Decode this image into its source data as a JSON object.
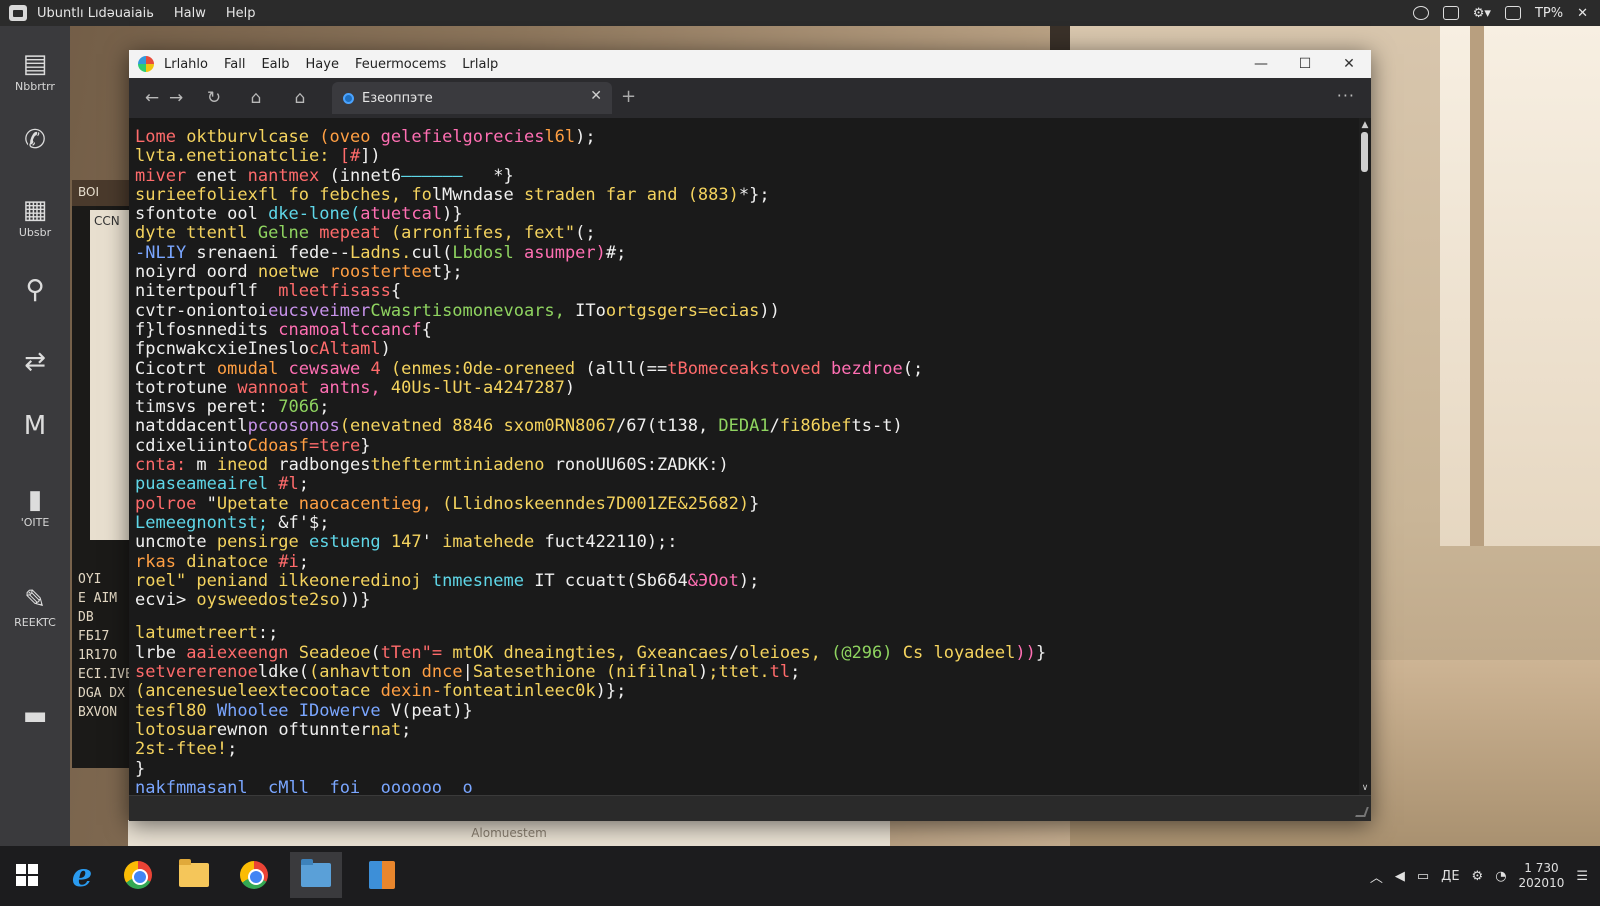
{
  "topbar": {
    "app_name": "Ubuntlı Lıdəuaiaiь",
    "menus": [
      "Halw",
      "Help"
    ],
    "battery": "TP%"
  },
  "dock": {
    "items": [
      {
        "label": "Nbbrtrr",
        "icon": "document-icon"
      },
      {
        "label": "",
        "icon": "phone-icon"
      },
      {
        "label": "Ubsbr",
        "icon": "notes-icon"
      },
      {
        "label": "",
        "icon": "search-icon"
      },
      {
        "label": "",
        "icon": "transfer-icon"
      },
      {
        "label": "",
        "icon": "mail-icon"
      },
      {
        "label": "'OITE",
        "icon": "file-icon"
      },
      {
        "label": "REEKTC",
        "icon": "edit-icon"
      },
      {
        "label": "",
        "icon": "folder-icon"
      }
    ]
  },
  "background_doc": {
    "header": "BOI",
    "paper_text": "CCN",
    "lines": [
      "OYI",
      "E AIM",
      "DB",
      "FБ17",
      "1R17O",
      "ECI.IVE",
      "DGA DX",
      "BXVON"
    ]
  },
  "background_status": "Alomuestem",
  "window": {
    "menus": [
      "Lrlahlo",
      "Fall",
      "Ealb",
      "Haye",
      "Feuermocems",
      "Lrlalp"
    ],
    "controls": {
      "minimize": "—",
      "maximize": "☐",
      "close": "✕"
    },
    "nav": {
      "back": "←",
      "forward": "→",
      "reload": "↻",
      "home": "⌂",
      "home2": "⌂",
      "more": "···",
      "new_tab": "+"
    },
    "tab": {
      "title": "Eзеоппэте",
      "close": "✕"
    }
  },
  "code": [
    [
      [
        "c-red",
        "Lome "
      ],
      [
        "c-yellow",
        "oktburvlcase "
      ],
      [
        "c-orange",
        "(oveo "
      ],
      [
        "c-pink",
        "gelefielgorecies"
      ],
      [
        "c-orange",
        "l6l"
      ],
      [
        "c-white",
        ");"
      ]
    ],
    [
      [
        "c-yellow",
        "lvta.enetionatclie: "
      ],
      [
        "c-red",
        "[#"
      ],
      [
        "c-white",
        "])"
      ]
    ],
    [
      [
        "c-red",
        "miver "
      ],
      [
        "c-white",
        "enet "
      ],
      [
        "c-red",
        "nantmex "
      ],
      [
        "c-white",
        "(innet6"
      ],
      [
        "c-cyan",
        "——————"
      ],
      [
        "c-white",
        "   *}"
      ]
    ],
    [
      [
        "c-yellow",
        "surieefoliexfl fo febches, fo"
      ],
      [
        "c-white",
        "lMwndase "
      ],
      [
        "c-yellow",
        "straden far and (883)"
      ],
      [
        "c-white",
        "*};"
      ]
    ],
    [
      [
        "c-white",
        "sfontote ool "
      ],
      [
        "c-cyan",
        "dke-lone("
      ],
      [
        "c-pink",
        "atuetcal"
      ],
      [
        "c-white",
        ")}"
      ]
    ],
    [
      [
        "c-yellow",
        "dyte ttentl "
      ],
      [
        "c-green",
        "Gelne "
      ],
      [
        "c-red",
        "mepeat "
      ],
      [
        "c-yellow",
        "(arronfifes, fext\""
      ],
      [
        "c-white",
        "(;"
      ]
    ],
    [
      [
        "c-blue",
        "-NLIY "
      ],
      [
        "c-white",
        "srenaeni "
      ],
      [
        "c-white",
        "fede--"
      ],
      [
        "c-yellow",
        "Ladns."
      ],
      [
        "c-white",
        "cul("
      ],
      [
        "c-green",
        "Lbdosl "
      ],
      [
        "c-pink",
        "asumper)"
      ],
      [
        "c-white",
        "#;"
      ]
    ],
    [
      [
        "c-white",
        "noiyrd oord "
      ],
      [
        "c-yellow",
        "noetwe "
      ],
      [
        "c-orange",
        "roostertee"
      ],
      [
        "c-white",
        "t};"
      ]
    ],
    [
      [
        "c-white",
        "nitertpouflf  "
      ],
      [
        "c-red",
        "mleetfisass"
      ],
      [
        "c-white",
        "{"
      ]
    ],
    [
      [
        "c-white",
        "cvtr-oniontoi"
      ],
      [
        "c-purple",
        "eucsveimer"
      ],
      [
        "c-green",
        "Cwasrtisomonevoars, "
      ],
      [
        "c-white",
        "ITo"
      ],
      [
        "c-yellow",
        "ortgsgers=ecias"
      ],
      [
        "c-white",
        "))"
      ]
    ],
    [
      [
        "c-white",
        "f}lfosnnedits "
      ],
      [
        "c-pink",
        "cnamoaltccancf"
      ],
      [
        "c-white",
        "{"
      ]
    ],
    [
      [
        "c-white",
        "fpcnwakcxieIneslo"
      ],
      [
        "c-red",
        "cAltaml"
      ],
      [
        "c-white",
        ")"
      ]
    ],
    [
      [
        "c-white",
        "Cicotrt "
      ],
      [
        "c-orange",
        "omudal "
      ],
      [
        "c-pink",
        "cewsawe "
      ],
      [
        "c-red",
        "4 "
      ],
      [
        "c-yellow",
        "(enmes:0de-oreneed "
      ],
      [
        "c-white",
        "(alll(=="
      ],
      [
        "c-red",
        "tBomeceakstoved "
      ],
      [
        "c-pink",
        "bezdroe"
      ],
      [
        "c-white",
        "(;"
      ]
    ],
    [
      [
        "c-white",
        "totrotune "
      ],
      [
        "c-red",
        "wannoat "
      ],
      [
        "c-pink",
        "antns, "
      ],
      [
        "c-yellow",
        "40Us-lUt-a4247287"
      ],
      [
        "c-white",
        ")"
      ]
    ],
    [
      [
        "c-white",
        "timsvs peret: "
      ],
      [
        "c-green",
        "706б"
      ],
      [
        "c-white",
        ";"
      ]
    ],
    [
      [
        "c-white",
        "natddacentl"
      ],
      [
        "c-purple",
        "pcoosonos"
      ],
      [
        "c-yellow",
        "(enevatned 8846 sxom0RN8067"
      ],
      [
        "c-white",
        "/67(t138, "
      ],
      [
        "c-green",
        "DEDA1"
      ],
      [
        "c-white",
        "/"
      ],
      [
        "c-yellow",
        "fi86bef"
      ],
      [
        "c-white",
        "ts-t)"
      ]
    ],
    [
      [
        "c-white",
        "cdixeliinto"
      ],
      [
        "c-orange",
        "Cdoasf"
      ],
      [
        "c-red",
        "=tere"
      ],
      [
        "c-white",
        "}"
      ]
    ],
    [
      [
        "c-red",
        "cnta: "
      ],
      [
        "c-white",
        "m "
      ],
      [
        "c-yellow",
        "ineod "
      ],
      [
        "c-white",
        "radbonges"
      ],
      [
        "c-yellow",
        "theftermtiniadeno "
      ],
      [
        "c-white",
        "ronoUU60S:ZADKK:)"
      ]
    ],
    [
      [
        "c-cyan",
        "puaseameairel "
      ],
      [
        "c-red",
        "#l"
      ],
      [
        "c-white",
        ";"
      ]
    ],
    [
      [
        "c-red",
        "polroe "
      ],
      [
        "c-white",
        "\""
      ],
      [
        "c-yellow",
        "Upetate "
      ],
      [
        "c-orange",
        "naocacentieg, "
      ],
      [
        "c-yellow",
        "(Llidnoskeenndes7D001ZE&25682)"
      ],
      [
        "c-white",
        "}"
      ]
    ],
    [
      [
        "c-cyan",
        "Lemeegnontst; "
      ],
      [
        "c-white",
        "&f'$;"
      ]
    ],
    [
      [
        "c-white",
        "uncmote "
      ],
      [
        "c-yellow",
        "pensirge "
      ],
      [
        "c-cyan",
        "estueng "
      ],
      [
        "c-yellow",
        "147"
      ],
      [
        "c-white",
        "' "
      ],
      [
        "c-yellow",
        "imatehede "
      ],
      [
        "c-white",
        "fuct422110);:"
      ]
    ],
    [
      [
        "c-orange",
        "rkas "
      ],
      [
        "c-yellow",
        "dinatoce "
      ],
      [
        "c-red",
        "#i"
      ],
      [
        "c-white",
        ";"
      ]
    ],
    [
      [
        "c-yellow",
        "roel\" peniand "
      ],
      [
        "c-yellow",
        "ilkeoneredinoj "
      ],
      [
        "c-cyan",
        "tnmesneme "
      ],
      [
        "c-white",
        "IT ccuatt(Sb6δ4"
      ],
      [
        "c-pink",
        "&ЭOot"
      ],
      [
        "c-white",
        ");"
      ]
    ],
    [
      [
        "c-white",
        "ecvi> "
      ],
      [
        "c-yellow",
        "oysweedoste2so"
      ],
      [
        "c-white",
        "))}"
      ]
    ],
    [
      [
        "gap",
        ""
      ]
    ],
    [
      [
        "c-yellow",
        "latumetreert"
      ],
      [
        "c-white",
        ":;"
      ]
    ],
    [
      [
        "c-white",
        "lrbe "
      ],
      [
        "c-red",
        "aaiexeengn "
      ],
      [
        "c-yellow",
        "Seadeoe"
      ],
      [
        "c-white",
        "("
      ],
      [
        "c-red",
        "tTen\"= "
      ],
      [
        "c-yellow",
        "mtOK "
      ],
      [
        "c-yellow",
        "dneaingties, "
      ],
      [
        "c-yellow",
        "Gxeancaes"
      ],
      [
        "c-white",
        "/"
      ],
      [
        "c-yellow",
        "oleioes, "
      ],
      [
        "c-green",
        "(@296) "
      ],
      [
        "c-yellow",
        "Cs "
      ],
      [
        "c-yellow",
        "loyadeel"
      ],
      [
        "c-pink",
        "))"
      ],
      [
        "c-white",
        "}"
      ]
    ],
    [
      [
        "c-red",
        "setvererenoe"
      ],
      [
        "c-white",
        "ldke("
      ],
      [
        "c-yellow",
        "(anhavtton "
      ],
      [
        "c-orange",
        "dnce"
      ],
      [
        "c-white",
        "|"
      ],
      [
        "c-yellow",
        "Satesethione "
      ],
      [
        "c-yellow",
        "(nifilnal"
      ],
      [
        "c-white",
        ")"
      ],
      [
        "c-yellow",
        ";ttet."
      ],
      [
        "c-red",
        "tl"
      ],
      [
        "c-white",
        ";"
      ]
    ],
    [
      [
        "c-yellow",
        "(ancenesueleextecootace "
      ],
      [
        "c-orange",
        "dexin-"
      ],
      [
        "c-yellow",
        "fonteatinleec0k"
      ],
      [
        "c-white",
        ")};"
      ]
    ],
    [
      [
        "c-yellow",
        "tesfl80 "
      ],
      [
        "c-blue",
        "Whoolee "
      ],
      [
        "c-blue",
        "IDowerve "
      ],
      [
        "c-white",
        "V(peat)}"
      ]
    ],
    [
      [
        "c-yellow",
        "lotosuar"
      ],
      [
        "c-white",
        "ewnon "
      ],
      [
        "c-white",
        "oftunnter"
      ],
      [
        "c-yellow",
        "nat"
      ],
      [
        "c-white",
        ";"
      ]
    ],
    [
      [
        "c-yellow",
        "2st-ftee!"
      ],
      [
        "c-white",
        ";"
      ]
    ],
    [
      [
        "c-white",
        "}"
      ]
    ],
    [
      [
        "c-blue",
        "nakfmmasanl  cMll  foi  oooooo  o"
      ]
    ]
  ],
  "taskbar": {
    "apps": [
      "edge-icon",
      "chrome-icon",
      "file-explorer-icon",
      "chrome-icon",
      "folder-icon",
      "3d-box-icon"
    ],
    "clock_time": "1 730",
    "clock_date": "202010",
    "tray_text": "ДЕ"
  }
}
